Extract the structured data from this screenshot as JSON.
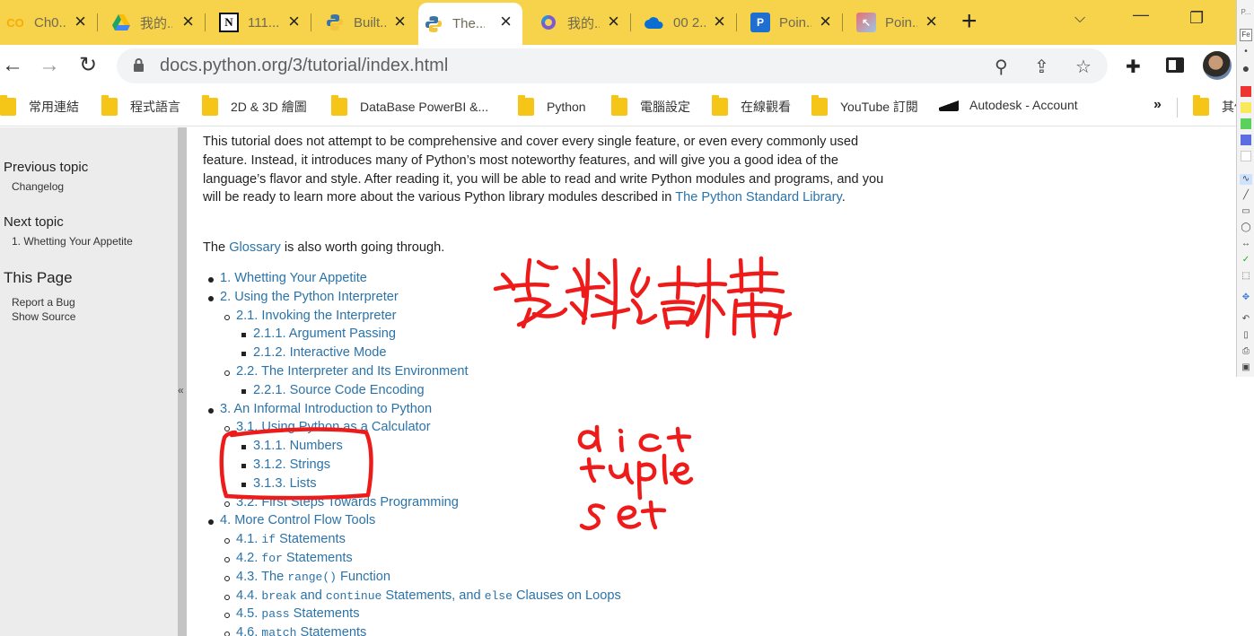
{
  "tabs": [
    {
      "title": "Ch0...",
      "icon": "colab-icon",
      "active": false
    },
    {
      "title": "我的...",
      "icon": "google-drive-icon",
      "active": false
    },
    {
      "title": "111...",
      "icon": "notion-icon",
      "active": false
    },
    {
      "title": "Built...",
      "icon": "python-icon",
      "active": false
    },
    {
      "title": "The...",
      "icon": "python-icon",
      "active": true
    },
    {
      "title": "我的...",
      "icon": "microsoft-365-icon",
      "active": false
    },
    {
      "title": "00 2...",
      "icon": "onedrive-icon",
      "active": false
    },
    {
      "title": "Poin...",
      "icon": "powerpoint-icon",
      "active": false
    },
    {
      "title": "Poin...",
      "icon": "pointer-app-icon",
      "active": false
    }
  ],
  "url": "docs.python.org/3/tutorial/index.html",
  "bookmarks": [
    {
      "label": "常用連結",
      "icon": "folder-icon"
    },
    {
      "label": "程式語言",
      "icon": "folder-icon"
    },
    {
      "label": "2D & 3D 繪圖",
      "icon": "folder-icon"
    },
    {
      "label": "DataBase  PowerBI &...",
      "icon": "folder-icon"
    },
    {
      "label": "Python",
      "icon": "folder-icon"
    },
    {
      "label": "電腦設定",
      "icon": "folder-icon"
    },
    {
      "label": "在線觀看",
      "icon": "folder-icon"
    },
    {
      "label": "YouTube 訂閱",
      "icon": "folder-icon"
    },
    {
      "label": "Autodesk - Account",
      "icon": "autodesk-icon"
    },
    {
      "label": "其他",
      "icon": "folder-icon"
    }
  ],
  "bookmarks_more": "»",
  "annotation_toolbar": {
    "title": "P...",
    "tab": "Fe"
  },
  "sidebar": {
    "previous_heading": "Previous topic",
    "previous_link": "Changelog",
    "next_heading": "Next topic",
    "next_link": "1. Whetting Your Appetite",
    "this_page_heading": "This Page",
    "report_bug": "Report a Bug",
    "show_source": "Show Source"
  },
  "collapse_glyph": "«",
  "intro": {
    "text": "This tutorial does not attempt to be comprehensive and cover every single feature, or even every commonly used feature. Instead, it introduces many of Python’s most noteworthy features, and will give you a good idea of the language’s flavor and style. After reading it, you will be able to read and write Python modules and programs, and you will be ready to learn more about the various Python library modules described in ",
    "link": "The Python Standard Library",
    "end": "."
  },
  "glossary": {
    "before": "The ",
    "link": "Glossary",
    "after": " is also worth going through."
  },
  "toc": [
    {
      "level": 1,
      "text": "1. Whetting Your Appetite"
    },
    {
      "level": 1,
      "text": "2. Using the Python Interpreter"
    },
    {
      "level": 2,
      "text": "2.1. Invoking the Interpreter"
    },
    {
      "level": 3,
      "text": "2.1.1. Argument Passing"
    },
    {
      "level": 3,
      "text": "2.1.2. Interactive Mode"
    },
    {
      "level": 2,
      "text": "2.2. The Interpreter and Its Environment"
    },
    {
      "level": 3,
      "text": "2.2.1. Source Code Encoding"
    },
    {
      "level": 1,
      "text": "3. An Informal Introduction to Python"
    },
    {
      "level": 2,
      "text": "3.1. Using Python as a Calculator"
    },
    {
      "level": 3,
      "text": "3.1.1. Numbers"
    },
    {
      "level": 3,
      "text": "3.1.2. Strings"
    },
    {
      "level": 3,
      "text": "3.1.3. Lists"
    },
    {
      "level": 2,
      "text": "3.2. First Steps Towards Programming"
    },
    {
      "level": 1,
      "text": "4. More Control Flow Tools"
    },
    {
      "level": 2,
      "parts": [
        [
          "4.1. ",
          false
        ],
        [
          "if",
          true
        ],
        [
          " Statements",
          false
        ]
      ]
    },
    {
      "level": 2,
      "parts": [
        [
          "4.2. ",
          false
        ],
        [
          "for",
          true
        ],
        [
          " Statements",
          false
        ]
      ]
    },
    {
      "level": 2,
      "parts": [
        [
          "4.3. The ",
          false
        ],
        [
          "range()",
          true
        ],
        [
          " Function",
          false
        ]
      ]
    },
    {
      "level": 2,
      "parts": [
        [
          "4.4. ",
          false
        ],
        [
          "break",
          true
        ],
        [
          " and ",
          false
        ],
        [
          "continue",
          true
        ],
        [
          " Statements, and ",
          false
        ],
        [
          "else",
          true
        ],
        [
          " Clauses on Loops",
          false
        ]
      ]
    },
    {
      "level": 2,
      "parts": [
        [
          "4.5. ",
          false
        ],
        [
          "pass",
          true
        ],
        [
          " Statements",
          false
        ]
      ]
    },
    {
      "level": 2,
      "parts": [
        [
          "4.6. ",
          false
        ],
        [
          "match",
          true
        ],
        [
          " Statements",
          false
        ]
      ]
    }
  ],
  "handwriting": {
    "title": "资料结构",
    "lines": [
      "dict",
      "tuple",
      "set"
    ],
    "color": "#ee1b1b"
  }
}
